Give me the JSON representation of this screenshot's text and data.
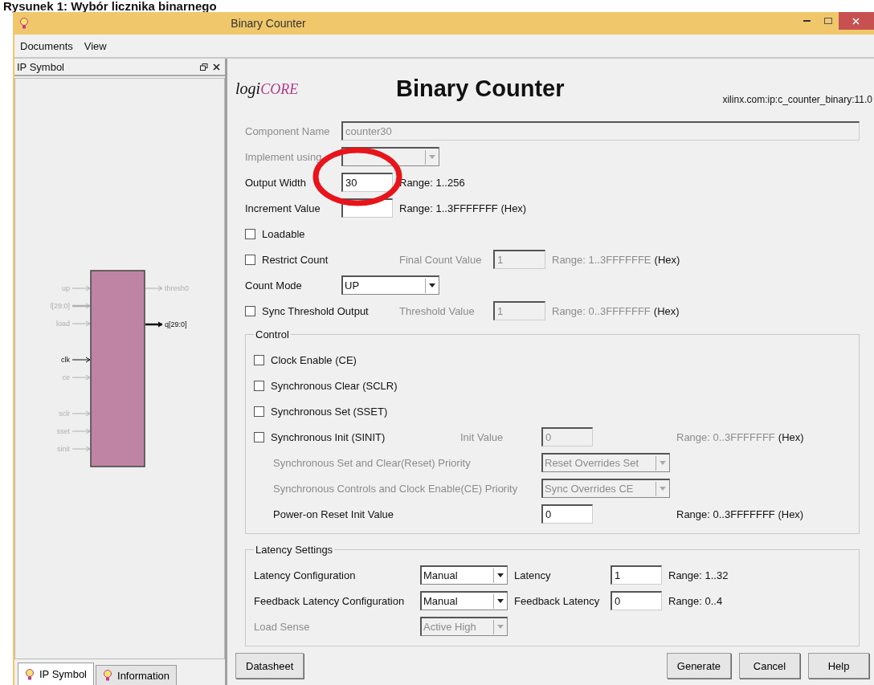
{
  "caption": "Rysunek 1: Wybór licznika binarnego",
  "window": {
    "title": "Binary Counter"
  },
  "menu": [
    {
      "label": "Documents"
    },
    {
      "label": "View"
    }
  ],
  "side_panel": {
    "title": "IP Symbol",
    "input_groups": [
      [
        {
          "name": "up",
          "active": false,
          "bus": false
        },
        {
          "name": "l[29:0]",
          "active": false,
          "bus": true
        },
        {
          "name": "load",
          "active": false,
          "bus": false
        }
      ],
      [
        {
          "name": "clk",
          "active": true,
          "bus": false
        },
        {
          "name": "ce",
          "active": false,
          "bus": false
        }
      ],
      [
        {
          "name": "sclr",
          "active": false,
          "bus": false
        },
        {
          "name": "sset",
          "active": false,
          "bus": false
        },
        {
          "name": "sinit",
          "active": false,
          "bus": false
        }
      ]
    ],
    "outputs": [
      {
        "name": "thresh0",
        "active": false,
        "bus": false
      },
      {
        "name": "q[29:0]",
        "active": true,
        "bus": true
      }
    ],
    "tabs": [
      {
        "label": "IP Symbol",
        "selected": true
      },
      {
        "label": "Information",
        "selected": false
      }
    ]
  },
  "form": {
    "logo": {
      "lead": "logi",
      "tail": "CORE"
    },
    "title": "Binary Counter",
    "core_id": "xilinx.com:ip:c_counter_binary:11.0",
    "sections": [
      {
        "kind": "general",
        "rows": [
          {
            "kind": "label",
            "label": "Component Name",
            "disabled": true,
            "input": {
              "kind": "wide",
              "value": "counter30",
              "disabled": true
            }
          },
          {
            "kind": "label",
            "label": "Implement using",
            "disabled": true,
            "input": {
              "kind": "select",
              "disabled": true
            }
          },
          {
            "kind": "label",
            "label": "Output Width",
            "disabled": false,
            "input": {
              "kind": "text",
              "value": "30",
              "disabled": false
            },
            "range": {
              "text": "Range: 1..256",
              "disabled": false
            }
          },
          {
            "kind": "label",
            "label": "Increment Value",
            "disabled": false,
            "input": {
              "kind": "text",
              "disabled": false
            },
            "range": {
              "text": "Range: 1..3FFFFFFF (Hex)",
              "disabled": false
            }
          },
          {
            "kind": "check",
            "label": "Loadable",
            "disabled": false,
            "checked": false
          },
          {
            "kind": "check",
            "label": "Restrict Count",
            "disabled": false,
            "checked": false,
            "param": {
              "label": "Final Count Value",
              "input": {
                "kind": "text",
                "value": "1",
                "disabled": true
              }
            },
            "range": {
              "text": "Range: 1..3FFFFFFE",
              "disabled": true
            },
            "unit": "(Hex)"
          },
          {
            "kind": "label",
            "label": "Count Mode",
            "disabled": false,
            "input": {
              "kind": "select",
              "value": "UP",
              "disabled": false
            }
          },
          {
            "kind": "check",
            "label": "Sync Threshold Output",
            "disabled": false,
            "checked": false,
            "param": {
              "label": "Threshold Value",
              "input": {
                "kind": "text",
                "value": "1",
                "disabled": true
              }
            },
            "range": {
              "text": "Range: 0..3FFFFFFF",
              "disabled": true
            },
            "unit": "(Hex)"
          }
        ]
      },
      {
        "kind": "group",
        "title": "Control",
        "rows": [
          {
            "kind": "check",
            "label": "Clock Enable (CE)",
            "disabled": false,
            "checked": false
          },
          {
            "kind": "check",
            "label": "Synchronous Clear (SCLR)",
            "disabled": false,
            "checked": false
          },
          {
            "kind": "check",
            "label": "Synchronous Set (SSET)",
            "disabled": false,
            "checked": false
          },
          {
            "kind": "check",
            "label": "Synchronous Init (SINIT)",
            "disabled": false,
            "checked": false,
            "param": {
              "label": "Init Value",
              "input": {
                "kind": "text",
                "value": "0",
                "disabled": true
              }
            },
            "range": {
              "text": "Range: 0..3FFFFFFF",
              "disabled": true
            },
            "unit": "(Hex)"
          },
          {
            "kind": "option",
            "label": "Synchronous Set and Clear(Reset) Priority",
            "disabled": true,
            "input": {
              "kind": "select",
              "value": "Reset Overrides Set",
              "disabled": true
            }
          },
          {
            "kind": "option",
            "label": "Synchronous Controls and Clock Enable(CE) Priority",
            "disabled": true,
            "input": {
              "kind": "select",
              "value": "Sync Overrides CE",
              "disabled": true
            }
          },
          {
            "kind": "option",
            "label": "Power-on Reset Init Value",
            "disabled": false,
            "input": {
              "kind": "text",
              "value": "0",
              "disabled": false
            },
            "range": {
              "text": "Range: 0..3FFFFFFF (Hex)",
              "disabled": false
            }
          }
        ]
      },
      {
        "kind": "latency",
        "title": "Latency Settings",
        "rows": [
          {
            "kind": "label",
            "label": "Latency Configuration",
            "disabled": false,
            "input": {
              "kind": "select",
              "value": "Manual",
              "disabled": false
            },
            "param": {
              "label": "Latency",
              "input": {
                "kind": "text",
                "value": "1",
                "disabled": false
              }
            },
            "range": {
              "text": "Range: 1..32",
              "disabled": false
            }
          },
          {
            "kind": "label",
            "label": "Feedback Latency Configuration",
            "disabled": false,
            "input": {
              "kind": "select",
              "value": "Manual",
              "disabled": false
            },
            "param": {
              "label": "Feedback Latency",
              "input": {
                "kind": "text",
                "value": "0",
                "disabled": false
              }
            },
            "range": {
              "text": "Range: 0..4",
              "disabled": false
            }
          },
          {
            "kind": "label",
            "label": "Load Sense",
            "disabled": true,
            "input": {
              "kind": "select",
              "value": "Active High",
              "disabled": true
            }
          }
        ]
      }
    ]
  },
  "buttons": [
    {
      "label": "Datasheet",
      "kind": "doc"
    },
    {
      "label": "Generate",
      "kind": "action"
    },
    {
      "label": "Cancel",
      "kind": "action"
    },
    {
      "label": "Help",
      "kind": "action"
    }
  ]
}
